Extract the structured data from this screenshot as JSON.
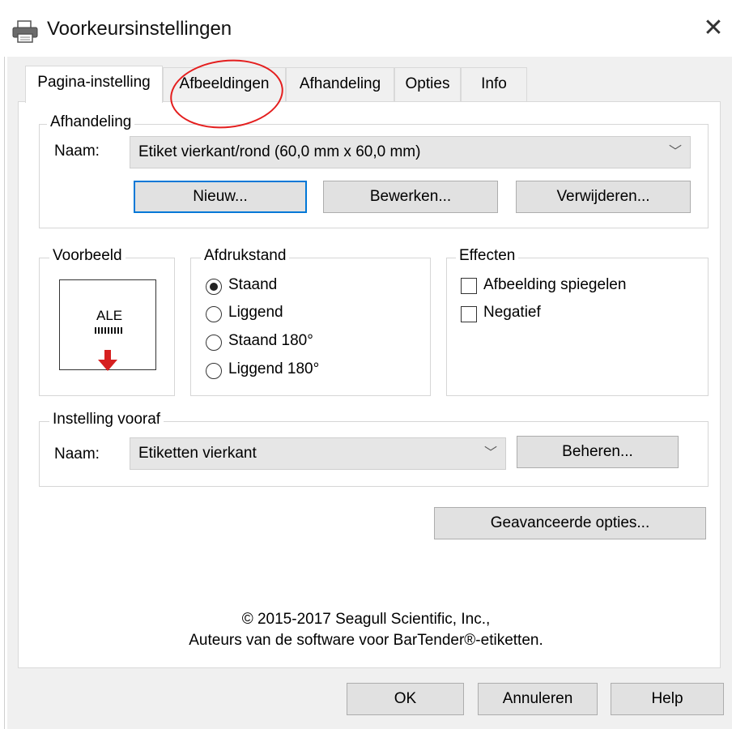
{
  "window": {
    "title": "Voorkeursinstellingen",
    "close_glyph": "✕",
    "icon": "printer-icon"
  },
  "tabs": [
    {
      "label": "Pagina-instelling",
      "active": true
    },
    {
      "label": "Afbeeldingen",
      "active": false
    },
    {
      "label": "Afhandeling",
      "active": false
    },
    {
      "label": "Opties",
      "active": false
    },
    {
      "label": "Info",
      "active": false
    }
  ],
  "afhandeling": {
    "legend": "Afhandeling",
    "naam_label": "Naam:",
    "naam_value": "Etiket vierkant/rond (60,0 mm x 60,0 mm)",
    "buttons": {
      "new": "Nieuw...",
      "edit": "Bewerken...",
      "delete": "Verwijderen..."
    }
  },
  "voorbeeld": {
    "legend": "Voorbeeld",
    "preview_text": "ALE"
  },
  "afdrukstand": {
    "legend": "Afdrukstand",
    "options": [
      "Staand",
      "Liggend",
      "Staand 180°",
      "Liggend 180°"
    ],
    "selected": "Staand"
  },
  "effecten": {
    "legend": "Effecten",
    "options": [
      {
        "label": "Afbeelding spiegelen",
        "checked": false
      },
      {
        "label": "Negatief",
        "checked": false
      }
    ]
  },
  "instelling_vooraf": {
    "legend": "Instelling vooraf",
    "naam_label": "Naam:",
    "naam_value": "Etiketten vierkant",
    "manage_button": "Beheren..."
  },
  "advanced_button": "Geavanceerde opties...",
  "footer": {
    "line1": "© 2015-2017 Seagull Scientific, Inc.,",
    "line2": "Auteurs van de software voor BarTender®-etiketten."
  },
  "dialog_buttons": {
    "ok": "OK",
    "cancel": "Annuleren",
    "help": "Help"
  },
  "colors": {
    "annotation": "#e41e1e",
    "focus": "#0078d7",
    "preview_arrow": "#d62020"
  }
}
